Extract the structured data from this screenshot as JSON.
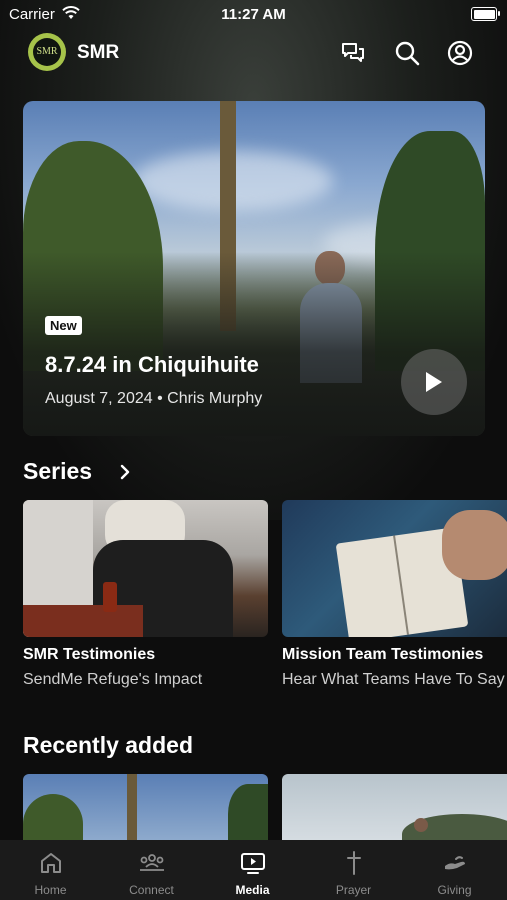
{
  "status_bar": {
    "carrier": "Carrier",
    "time": "11:27 AM"
  },
  "header": {
    "logo_text": "SMR",
    "app_name": "SMR"
  },
  "featured": {
    "badge": "New",
    "title": "8.7.24 in Chiquihuite",
    "subtitle": "August 7, 2024 • Chris Murphy"
  },
  "series": {
    "heading": "Series",
    "items": [
      {
        "title": "SMR Testimonies",
        "subtitle": "SendMe Refuge's Impact"
      },
      {
        "title": "Mission Team Testimonies",
        "subtitle": "Hear What Teams Have To Say"
      }
    ]
  },
  "recently_added": {
    "heading": "Recently added"
  },
  "tab_bar": {
    "tabs": [
      {
        "label": "Home"
      },
      {
        "label": "Connect"
      },
      {
        "label": "Media"
      },
      {
        "label": "Prayer"
      },
      {
        "label": "Giving"
      }
    ],
    "active": "Media"
  },
  "colors": {
    "background": "#0d0d0d",
    "logo_ring": "#a6c34a",
    "tab_inactive": "#8c8c8c",
    "tab_active": "#ffffff"
  }
}
